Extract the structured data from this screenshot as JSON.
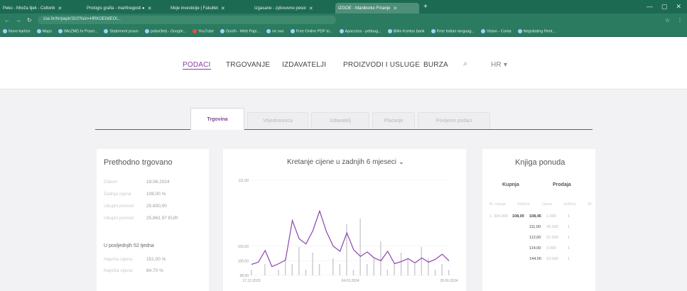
{
  "browser": {
    "tabs": [
      {
        "label": "Peko - Mreža lijek - Celtonk",
        "active": false
      },
      {
        "label": "Prologis grafia - marifnegosti ●",
        "active": false
      },
      {
        "label": "Moje investicije | Fakultet",
        "active": false
      },
      {
        "label": "Izgasane - zplosovne pesoi",
        "active": false
      },
      {
        "label": "IZGOE - Maniborko Finanje",
        "active": true
      }
    ],
    "url": "zse.hr/hr/papir/310?isin=HRKOEIMEOI...",
    "bookmarks": [
      "Nove kartice",
      "Maps",
      "IMoZMD.hr Posel...",
      "Statement pravo",
      "pobočitelj - Google...",
      "YouTube",
      "Gooth - Web Papi...",
      "ne ovo",
      "Free Online PDF to...",
      "Apaccess - pelloug...",
      "Bilim Kontos bank",
      "Free Indian languag...",
      "Vision - Coma",
      "Negotiating Rent...",
      "Kit"
    ],
    "window_controls": [
      "—",
      "▢",
      "✕"
    ],
    "toolbar_icons": [
      "←",
      "→",
      "↻"
    ],
    "right_icons": [
      "☆",
      "⋮"
    ]
  },
  "site_nav": {
    "items": [
      "PODACI",
      "TRGOVANJE",
      "IZDAVATELJI",
      "PROIZVODI I USLUGE",
      "BURZA"
    ],
    "selected": 0,
    "lang": "HR ▾",
    "search_icon": "⌕"
  },
  "page_tabs": [
    "Trgovina",
    "Vrijednosnica",
    "Izdavatelj",
    "Plaćanje",
    "Povijesni podaci"
  ],
  "left_panel": {
    "title": "Prethodno trgovano",
    "rows": [
      {
        "k": "Datum",
        "v": "19.06.2024"
      },
      {
        "k": "Zadnja cijena",
        "v": "108,00 %"
      },
      {
        "k": "Ukupni promet",
        "v": "25.800,00"
      },
      {
        "k": "Ukupni promet",
        "v": "25.861.97 EUR"
      }
    ],
    "subtitle": "U posljednjih 52 tjedna",
    "rows2": [
      {
        "k": "Najviša cijena",
        "v": "151,00 %"
      },
      {
        "k": "Najniža cijena",
        "v": "84,70 %"
      }
    ]
  },
  "chart_panel": {
    "title": "Kretanje cijene u zadnjih 6 mjeseci ⌄",
    "accent": "#8e44ad"
  },
  "chart_data": {
    "type": "line",
    "title": "Kretanje cijene u zadnjih 6 mjeseci",
    "yticks": [
      "111,00",
      "102,00",
      "100,00",
      "98,00"
    ],
    "xticks": [
      "17.12.2023",
      "04.03.2024",
      "20.06.2024"
    ],
    "series": [
      {
        "values": [
          99.5,
          99.8,
          101.4,
          99.2,
          99.6,
          100.1,
          105.5,
          103.0,
          102.3,
          104.1,
          106.8,
          104.0,
          102.0,
          101.3,
          103.8,
          101.5,
          100.6,
          101.2,
          100.4,
          100.0,
          101.3,
          99.6,
          99.9,
          100.3,
          99.7,
          100.4,
          99.8,
          100.2,
          100.9,
          100.0
        ]
      }
    ],
    "volume": [
      1,
      0,
      2,
      0,
      1,
      3,
      2,
      5,
      1,
      4,
      2,
      0,
      3,
      2,
      9,
      1,
      10,
      2,
      3,
      6,
      1,
      2,
      4,
      3,
      2,
      5,
      3,
      1,
      2,
      1
    ]
  },
  "order_book": {
    "title": "Knjiga ponuda",
    "buy_label": "Kupnja",
    "sell_label": "Prodaja",
    "headers": [
      "Br. naloga",
      "Količina",
      "Cijena",
      "Količina",
      "Br."
    ],
    "rows": [
      {
        "n": "1",
        "q": "304.000",
        "bp": "108,00",
        "sp": "108,45",
        "sq": "1.000",
        "sn": "1"
      },
      {
        "n": "",
        "q": "",
        "bp": "",
        "sp": "111,00",
        "sq": "30.000",
        "sn": "1"
      },
      {
        "n": "",
        "q": "",
        "bp": "",
        "sp": "112,00",
        "sq": "22.000",
        "sn": "1"
      },
      {
        "n": "",
        "q": "",
        "bp": "",
        "sp": "114,00",
        "sq": "3.000",
        "sn": "1"
      },
      {
        "n": "",
        "q": "",
        "bp": "",
        "sp": "144,00",
        "sq": "10.000",
        "sn": "1"
      }
    ]
  }
}
